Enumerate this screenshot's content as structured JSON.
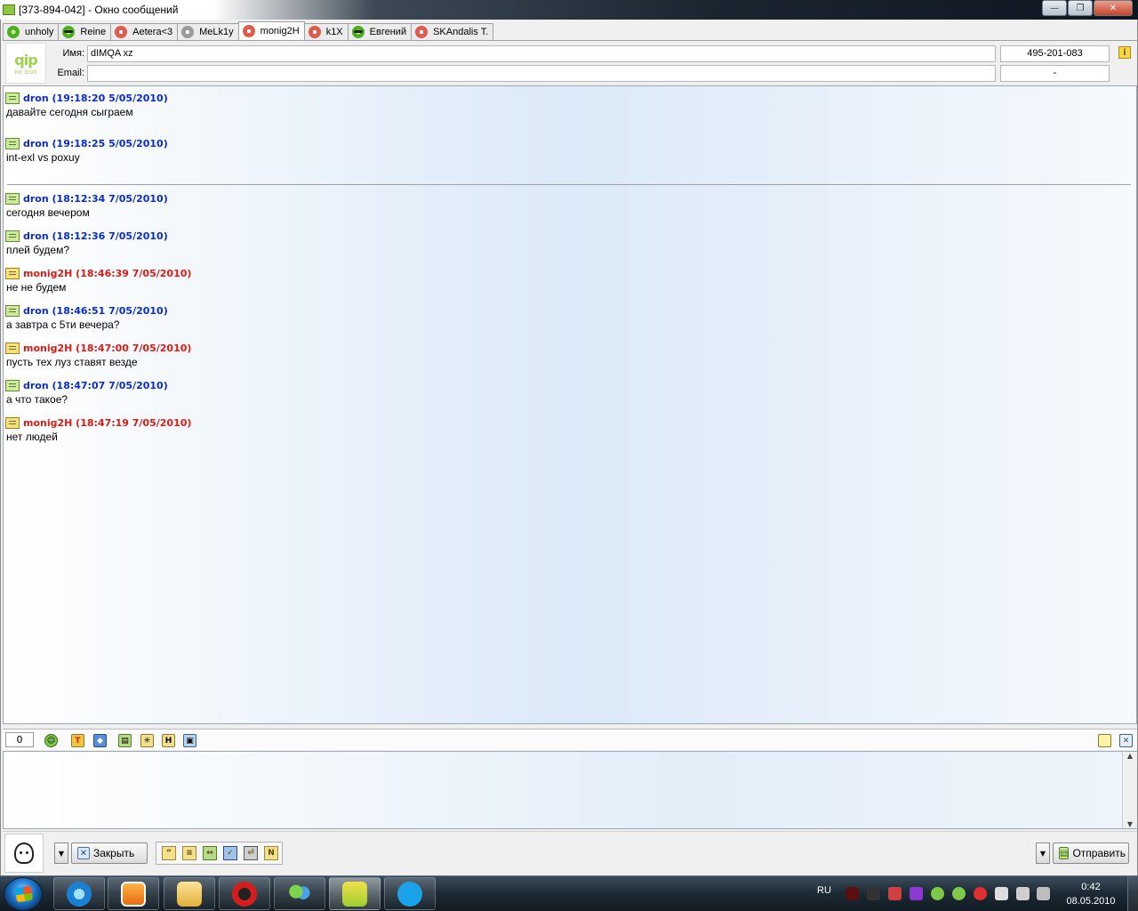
{
  "window": {
    "title": "[373-894-042] - Окно сообщений"
  },
  "tabs": [
    {
      "label": "unholy",
      "icon": "flower-green-icon",
      "active": false
    },
    {
      "label": "Reine",
      "icon": "flower-sunglasses-icon",
      "active": false
    },
    {
      "label": "Aetera<3",
      "icon": "flower-red-icon",
      "active": false
    },
    {
      "label": "MeLk1y",
      "icon": "flower-gray-icon",
      "active": false
    },
    {
      "label": "monig2H",
      "icon": "flower-red-icon",
      "active": true
    },
    {
      "label": "k1X",
      "icon": "flower-red-icon",
      "active": false
    },
    {
      "label": "Евгений",
      "icon": "flower-sunglasses-icon",
      "active": false
    },
    {
      "label": "SKAndalis T.",
      "icon": "flower-red-icon",
      "active": false
    }
  ],
  "contact": {
    "avatar_logo": "qip",
    "avatar_caption": "no icon",
    "name_label": "Имя:",
    "name_value": "dIMQA  xz",
    "email_label": "Email:",
    "email_value": "",
    "uin": "495-201-083",
    "status_extra": "-"
  },
  "messages": [
    {
      "sender": "dron",
      "header": "dron (19:18:20 5/05/2010)",
      "text": "давайте сегодня сыграем",
      "direction": "in"
    },
    {
      "sender": "dron",
      "header": "dron (19:18:25 5/05/2010)",
      "text": "int-exl vs poxuy",
      "direction": "in"
    },
    {
      "sender": "dron",
      "header": "dron (18:12:34 7/05/2010)",
      "text": "сегодня вечером",
      "direction": "in"
    },
    {
      "sender": "dron",
      "header": "dron (18:12:36 7/05/2010)",
      "text": "плей будем?",
      "direction": "in"
    },
    {
      "sender": "monig2H",
      "header": "monig2H (18:46:39 7/05/2010)",
      "text": "не не будем",
      "direction": "out"
    },
    {
      "sender": "dron",
      "header": "dron (18:46:51 7/05/2010)",
      "text": "а завтра с 5ти вечера?",
      "direction": "in"
    },
    {
      "sender": "monig2H",
      "header": "monig2H (18:47:00 7/05/2010)",
      "text": "пусть тех луз ставят везде",
      "direction": "out"
    },
    {
      "sender": "dron",
      "header": "dron (18:47:07 7/05/2010)",
      "text": "а что такое?",
      "direction": "in"
    },
    {
      "sender": "monig2H",
      "header": "monig2H (18:47:19 7/05/2010)",
      "text": "нет людей",
      "direction": "out"
    }
  ],
  "colors": {
    "incoming": "#0a2bd1",
    "outgoing": "#e01a12"
  },
  "compose": {
    "char_count": "0",
    "text": "",
    "toolbar_icons": [
      "smiley-icon",
      "font-icon",
      "color-icon",
      "save-icon",
      "attach-icon",
      "history-icon",
      "send-file-icon"
    ]
  },
  "bottom": {
    "close_label": "Закрыть",
    "send_label": "Отправить",
    "format_icons": [
      "quote-icon",
      "text-icon",
      "translit-icon",
      "spell-icon",
      "insert-icon",
      "note-icon"
    ]
  },
  "taskbar": {
    "language": "RU",
    "time": "0:42",
    "date": "08.05.2010",
    "apps": [
      "internet-explorer-icon",
      "media-player-icon",
      "explorer-folder-icon",
      "garena-icon",
      "messenger-icon",
      "qip-icon",
      "skype-icon"
    ]
  }
}
